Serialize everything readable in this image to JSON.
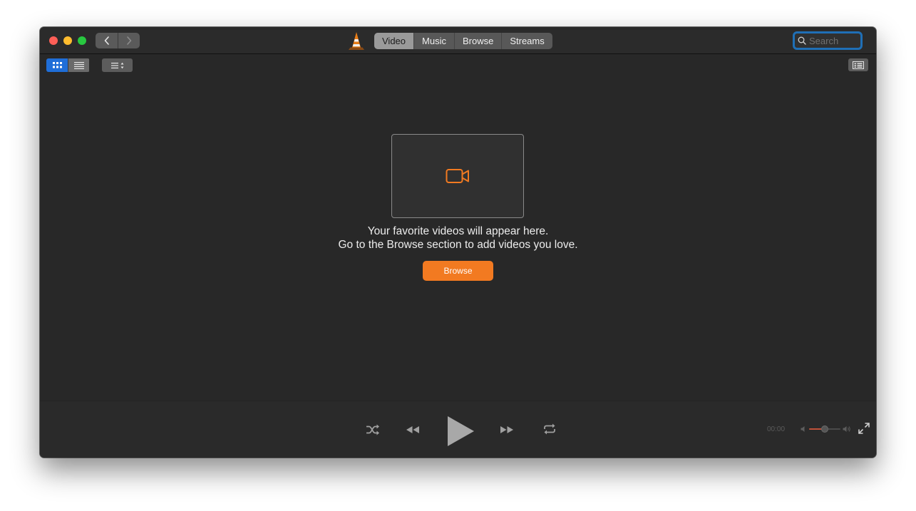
{
  "tabs": [
    {
      "label": "Video",
      "active": true
    },
    {
      "label": "Music",
      "active": false
    },
    {
      "label": "Browse",
      "active": false
    },
    {
      "label": "Streams",
      "active": false
    }
  ],
  "search": {
    "placeholder": "Search"
  },
  "empty_state": {
    "line1": "Your favorite videos will appear here.",
    "line2": "Go to the Browse section to add videos you love.",
    "button_label": "Browse"
  },
  "player": {
    "time": "00:00",
    "volume_fraction": 0.5
  },
  "icons": {
    "accent": "#f27a21",
    "selection": "#1f6ed8",
    "names": [
      "chevron-left-icon",
      "chevron-right-icon",
      "vlc-cone-icon",
      "search-icon",
      "grid-view-icon",
      "list-view-icon",
      "sort-icon",
      "sidebar-toggle-icon",
      "video-camera-icon",
      "shuffle-icon",
      "rewind-icon",
      "play-icon",
      "fast-forward-icon",
      "repeat-icon",
      "volume-low-icon",
      "volume-high-icon",
      "fullscreen-icon"
    ]
  }
}
